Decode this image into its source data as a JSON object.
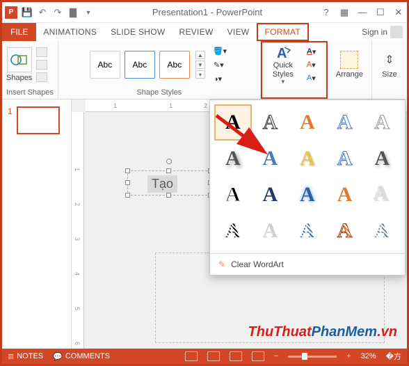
{
  "titlebar": {
    "app_initials": "P",
    "title": "Presentation1 - PowerPoint"
  },
  "tabs": {
    "file": "FILE",
    "items": [
      "ANIMATIONS",
      "SLIDE SHOW",
      "REVIEW",
      "VIEW",
      "FORMAT"
    ],
    "signin": "Sign in"
  },
  "ribbon": {
    "shapes_label": "Shapes",
    "insert_shapes": "Insert Shapes",
    "shape_styles": "Shape Styles",
    "abc": "Abc",
    "quick_styles": "Quick Styles",
    "arrange": "Arrange",
    "size": "Size"
  },
  "ruler": {
    "h": [
      "1",
      "1",
      "2"
    ],
    "v": [
      "1",
      "2",
      "3",
      "4",
      "5",
      "6"
    ]
  },
  "thumbs": {
    "num": "1"
  },
  "slide": {
    "textbox_text": "Tạo"
  },
  "wordart": {
    "clear": "Clear WordArt",
    "eraser_glyph": "✎",
    "styles": [
      [
        {
          "fill": "#000",
          "stroke": "none",
          "shadow": "none"
        },
        {
          "fill": "#fff",
          "stroke": "#333",
          "shadow": "none",
          "weight": "normal"
        },
        {
          "fill": "#e07b2e",
          "stroke": "none",
          "shadow": "none"
        },
        {
          "fill": "#fff",
          "stroke": "#4a79b5",
          "shadow": "none"
        },
        {
          "fill": "#fff",
          "stroke": "#999",
          "shadow": "none"
        }
      ],
      [
        {
          "fill": "#555",
          "stroke": "none",
          "shadow": "3px 3px 6px rgba(0,0,0,0.4)"
        },
        {
          "fill": "#4a79b5",
          "stroke": "none",
          "shadow": "0 10px 6px -6px rgba(0,0,0,0.3)"
        },
        {
          "fill": "#e8c54a",
          "stroke": "none",
          "shadow": "1px 1px 2px rgba(0,0,0,0.3)"
        },
        {
          "fill": "#fff",
          "stroke": "#4a79b5",
          "shadow": "1px 1px 2px rgba(0,0,0,0.2)"
        },
        {
          "fill": "#555",
          "stroke": "none",
          "shadow": "2px 2px 4px rgba(0,0,0,0.3)"
        }
      ],
      [
        {
          "fill": "#000",
          "stroke": "#fff",
          "shadow": "0 0 4px #fff"
        },
        {
          "fill": "#1e3a6e",
          "stroke": "none",
          "shadow": "none"
        },
        {
          "fill": "#2a5fa0",
          "stroke": "none",
          "shadow": "0 0 6px #6aa0e0"
        },
        {
          "fill": "#e07b2e",
          "stroke": "none",
          "shadow": "none"
        },
        {
          "fill": "#ddd",
          "stroke": "none",
          "shadow": "-2px -2px 2px rgba(0,0,0,0.2)"
        }
      ],
      [
        {
          "fill": "#000",
          "stroke": "none",
          "pattern": "diag"
        },
        {
          "fill": "#d0d0d0",
          "stroke": "none",
          "inset": true
        },
        {
          "fill": "#3a6bb0",
          "stroke": "none",
          "pattern": "diag"
        },
        {
          "fill": "#e07b2e",
          "stroke": "#a05020",
          "pattern": "diag"
        },
        {
          "fill": "#5b7a99",
          "stroke": "none",
          "pattern": "diag"
        }
      ]
    ]
  },
  "status": {
    "notes": "NOTES",
    "comments": "COMMENTS",
    "zoom": "32%"
  },
  "watermark": {
    "part1": "ThuThuat",
    "part2": "PhanMem",
    "part3": ".vn"
  }
}
